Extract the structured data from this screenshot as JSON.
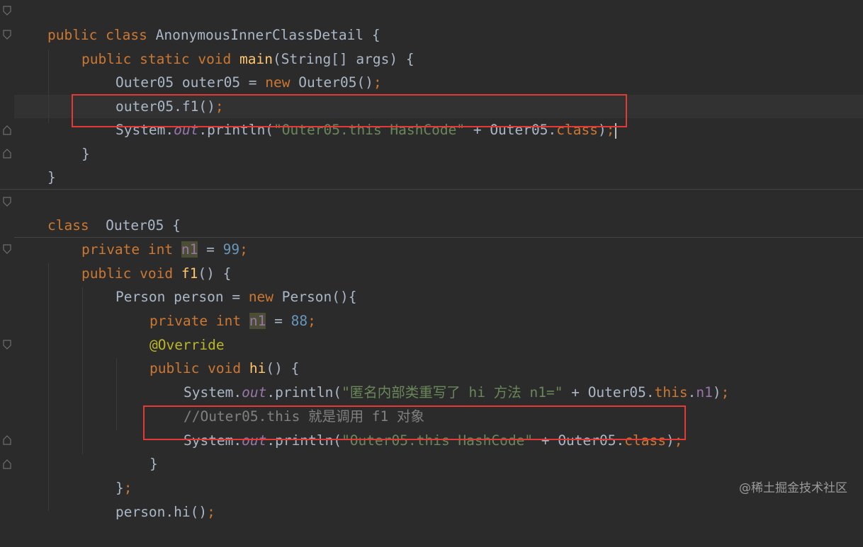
{
  "code": {
    "l1": {
      "a": "public class ",
      "b": "AnonymousInnerClassDetail {"
    },
    "l2": {
      "a": "public static void ",
      "b": "main",
      "c": "(String[] args) {"
    },
    "l3": {
      "a": "Outer05 outer05 = ",
      "b": "new ",
      "c": "Outer05()",
      "d": ";"
    },
    "l4": {
      "a": "outer05.f1()",
      "b": ";"
    },
    "l5": {
      "a": "System.",
      "b": "out",
      "c": ".println(",
      "d": "\"Outer05.this HashCode\"",
      "e": " + Outer05.",
      "f": "class",
      "g": ")",
      "h": ";"
    },
    "l6": {
      "a": "}"
    },
    "l7": {
      "a": "}"
    },
    "l8": {
      "a": "class ",
      "b": " Outer05 {"
    },
    "l9": {
      "a": "private int ",
      "b": "n1",
      "c": " = ",
      "d": "99",
      "e": ";"
    },
    "l10": {
      "a": "public void ",
      "b": "f1",
      "c": "() {"
    },
    "l11": {
      "a": "Person person = ",
      "b": "new ",
      "c": "Person(){"
    },
    "l12": {
      "a": "private int ",
      "b": "n1",
      "c": " = ",
      "d": "88",
      "e": ";"
    },
    "l13": {
      "a": "@Override"
    },
    "l14": {
      "a": "public void ",
      "b": "hi",
      "c": "() {"
    },
    "l15": {
      "a": "System.",
      "b": "out",
      "c": ".println(",
      "d": "\"匿名内部类重写了 hi 方法 n1=\"",
      "e": " + Outer05.",
      "f": "this",
      "g": ".",
      "h": "n1",
      "i": ")",
      "j": ";"
    },
    "l16": {
      "a": "//Outer05.this 就是调用 f1 对象"
    },
    "l17": {
      "a": "System.",
      "b": "out",
      "c": ".println(",
      "d": "\"Outer05.this HashCode\"",
      "e": " + Outer05.",
      "f": "class",
      "g": ")",
      "h": ";"
    },
    "l18": {
      "a": "}"
    },
    "l19": {
      "a": "}",
      "b": ";"
    },
    "l20": {
      "a": "person.hi()",
      "b": ";"
    }
  },
  "watermark": "@稀土掘金技术社区"
}
